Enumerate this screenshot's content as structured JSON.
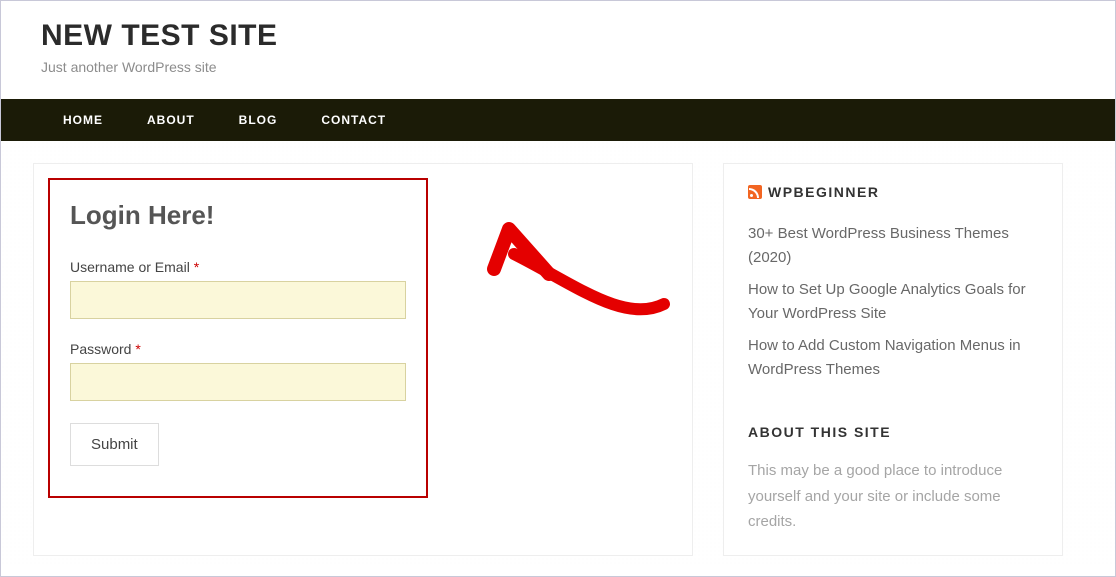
{
  "header": {
    "site_title": "NEW TEST SITE",
    "tagline": "Just another WordPress site"
  },
  "nav": {
    "items": [
      "HOME",
      "ABOUT",
      "BLOG",
      "CONTACT"
    ]
  },
  "login_form": {
    "title": "Login Here!",
    "username_label": "Username or Email",
    "password_label": "Password",
    "required_mark": "*",
    "submit_label": "Submit"
  },
  "sidebar": {
    "rss_widget": {
      "title": "WPBEGINNER",
      "items": [
        "30+ Best WordPress Business Themes (2020)",
        "How to Set Up Google Analytics Goals for Your WordPress Site",
        "How to Add Custom Navigation Menus in WordPress Themes"
      ]
    },
    "about_widget": {
      "title": "ABOUT THIS SITE",
      "text": "This may be a good place to introduce yourself and your site or include some credits."
    }
  }
}
